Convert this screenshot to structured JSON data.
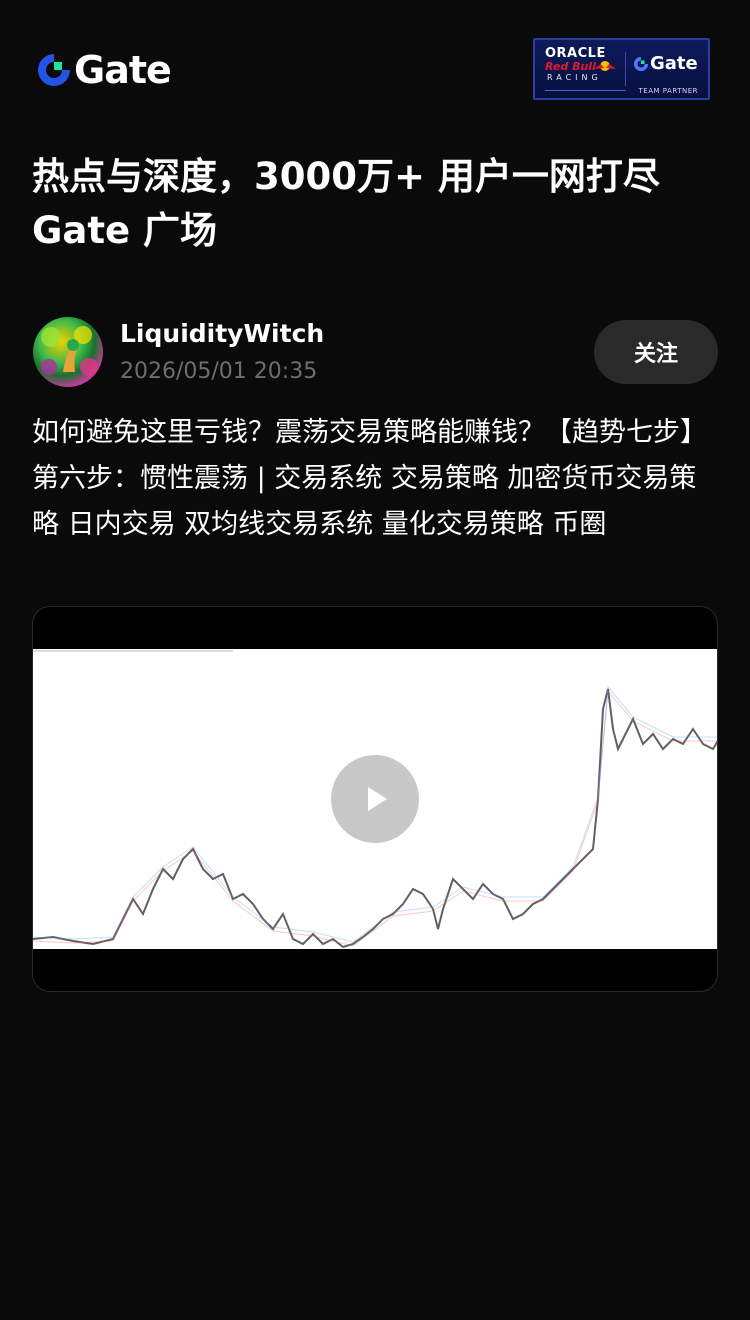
{
  "header": {
    "logo_text": "Gate",
    "partner": {
      "oracle": "ORACLE",
      "redbull": "Red Bull",
      "racing": "RACING",
      "gate": "Gate",
      "team": "TEAM PARTNER"
    }
  },
  "headline": "热点与深度，3000万+ 用户一网打尽 Gate 广场",
  "post": {
    "author": "LiquidityWitch",
    "time": "2026/05/01 20:35",
    "follow_label": "关注",
    "text": "如何避免这里亏钱？震荡交易策略能赚钱？【趋势七步】第六步：惯性震荡 | 交易系统 交易策略 加密货币交易策略 日内交易 双均线交易系统 量化交易策略 币圈"
  },
  "colors": {
    "background": "#0a0a0a",
    "brand_blue": "#2354e6",
    "brand_green": "#17e6a1",
    "follow_bg": "#2a2a2a",
    "muted_text": "#6e6e6e"
  },
  "icons": {
    "logo": "gate-logo-icon",
    "play": "play-icon"
  }
}
